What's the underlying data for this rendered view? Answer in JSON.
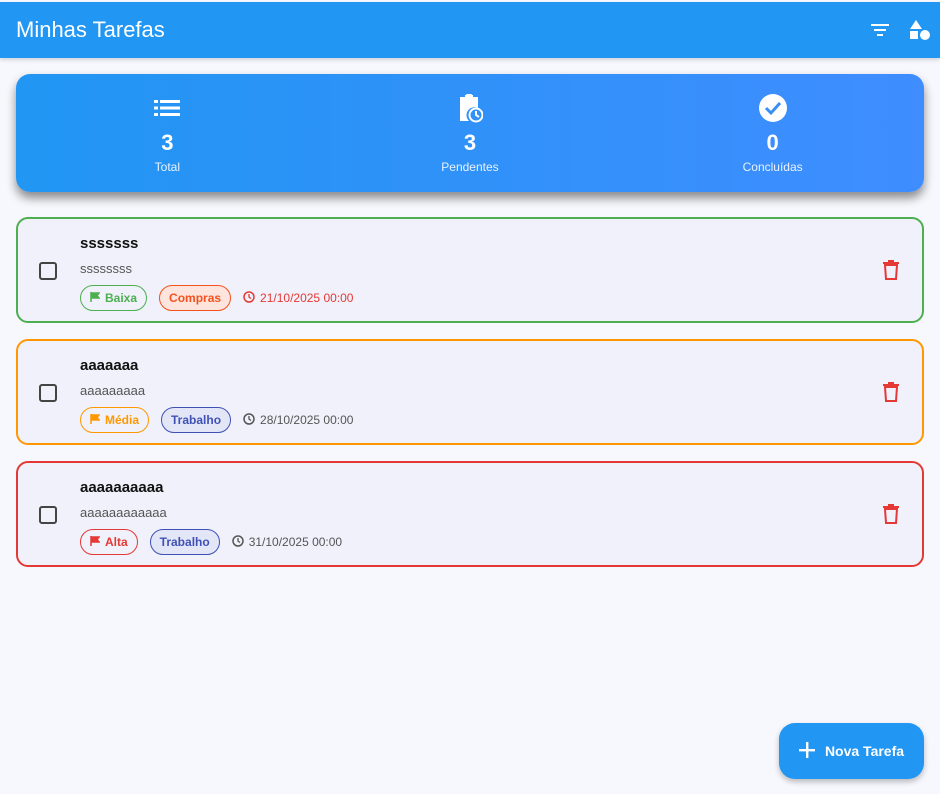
{
  "appbar": {
    "title": "Minhas Tarefas",
    "filter_icon": "filter-icon",
    "categories_icon": "shapes-icon"
  },
  "stats": [
    {
      "icon": "list-icon",
      "value": "3",
      "label": "Total"
    },
    {
      "icon": "clipboard-clock-icon",
      "value": "3",
      "label": "Pendentes"
    },
    {
      "icon": "check-circle-icon",
      "value": "0",
      "label": "Concluídas"
    }
  ],
  "tasks": [
    {
      "title": "sssssss",
      "description": "ssssssss",
      "priority": "Baixa",
      "category": "Compras",
      "date": "21/10/2025 00:00",
      "overdue": true,
      "checked": false,
      "border_color": "#4caf50"
    },
    {
      "title": "aaaaaaa",
      "description": "aaaaaaaaa",
      "priority": "Média",
      "category": "Trabalho",
      "date": "28/10/2025 00:00",
      "overdue": false,
      "checked": false,
      "border_color": "#ff9800"
    },
    {
      "title": "aaaaaaaaaa",
      "description": "aaaaaaaaaaaa",
      "priority": "Alta",
      "category": "Trabalho",
      "date": "31/10/2025 00:00",
      "overdue": false,
      "checked": false,
      "border_color": "#e53935"
    }
  ],
  "fab": {
    "label": "Nova Tarefa",
    "icon": "plus-icon"
  },
  "colors": {
    "primary": "#2196f3",
    "priority_low": "#4caf50",
    "priority_medium": "#ff9800",
    "priority_high": "#e53935",
    "category_shopping": "#f4511e",
    "category_work": "#3f51b5",
    "delete": "#e53935",
    "overdue": "#e53935"
  }
}
